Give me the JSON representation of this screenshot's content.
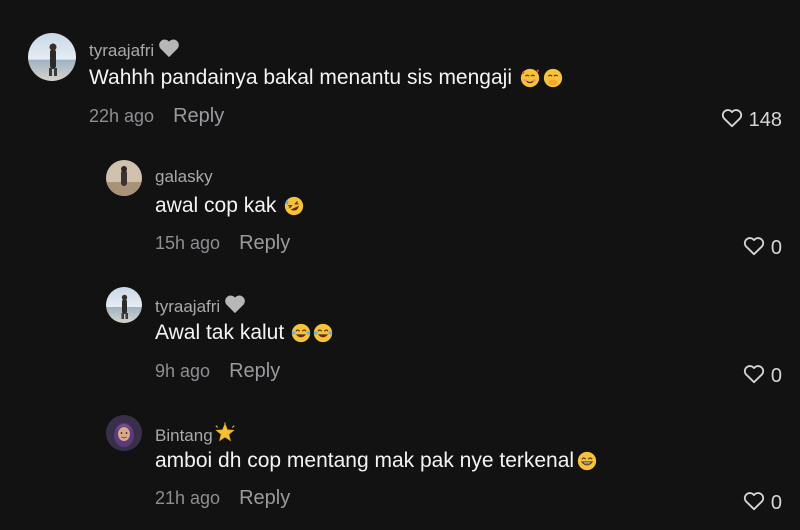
{
  "comments": [
    {
      "username": "tyraajafri",
      "text": "Wahhh pandainya bakal menantu sis mengaji",
      "time": "22h ago",
      "reply_label": "Reply",
      "likes": "148"
    },
    {
      "username": "galasky",
      "text": "awal cop kak",
      "time": "15h ago",
      "reply_label": "Reply",
      "likes": "0"
    },
    {
      "username": "tyraajafri",
      "text": "Awal tak kalut",
      "time": "9h ago",
      "reply_label": "Reply",
      "likes": "0"
    },
    {
      "username": "Bintang",
      "text": "amboi dh cop mentang mak pak nye terkenal",
      "time": "21h ago",
      "reply_label": "Reply",
      "likes": "0"
    }
  ],
  "colors": {
    "background": "#121212",
    "username": "#a9a9ad",
    "text": "#f4f4f4",
    "meta": "#8e8e93",
    "emoji_yellow": "#f7c23b"
  },
  "icons": {
    "badge": "gray-heart-icon",
    "like": "heart-outline-icon",
    "bintang_badge": "glowing-star-icon"
  }
}
